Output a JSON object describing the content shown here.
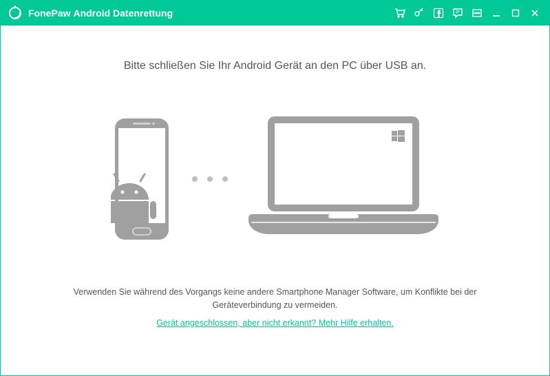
{
  "header": {
    "brand": "FonePaw",
    "product": "Android Datenrettung"
  },
  "main": {
    "heading": "Bitte schließen Sie Ihr Android Gerät an den PC über USB an.",
    "warning": "Verwenden Sie während des Vorgangs keine andere Smartphone Manager Software, um Konflikte bei der Geräteverbindung zu vermeiden.",
    "help_link": "Gerät angeschlossen, aber nicht erkannt? Mehr Hilfe erhalten."
  },
  "colors": {
    "accent": "#00c896",
    "illustration": "#a0a0a0"
  }
}
